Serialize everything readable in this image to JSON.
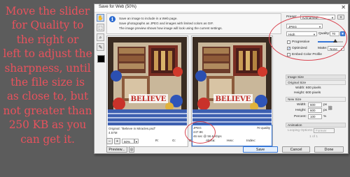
{
  "instruction": "Move the slider\nfor Quality to\nthe right or\nleft to adjust the\nsharpness, until\nthe file size is\nas close to, but\nnot greater than\n250 KB as you\ncan get it.",
  "window": {
    "title": "Save for Web (50%)",
    "close": "✕"
  },
  "toolbar_icons": [
    "hand-tool-icon",
    "zoom-tool-icon",
    "eyedropper-icon",
    "slice-select-icon"
  ],
  "info": {
    "lines": [
      "Save an image to include in a Web page.",
      "Save photographs as JPEG and images with limited colors as GIF.",
      "The image preview shows how image will look using the current settings."
    ]
  },
  "original": {
    "caption_label": "Original: \"Believe in Miracles.psd\"",
    "size": "4.57M",
    "title_text": "BELIEVE"
  },
  "optimized": {
    "format": "JPEG",
    "size": "247.9K",
    "time": "46 sec @ 56.6 Kbps",
    "quality_text": "70 quality",
    "title_text": "BELIEVE"
  },
  "bottom": {
    "zoom": "50%",
    "zoom_options_icon": "chevron-down-icon",
    "r_label": "R:",
    "g_label": "G:",
    "b_label": "B:",
    "alpha_label": "Alpha:",
    "hex_label": "Hex:",
    "index_label": "Index:",
    "preview_button": "Preview...",
    "save_button": "Save",
    "cancel_button": "Cancel",
    "done_button": "Done"
  },
  "settings": {
    "preset_label": "Preset:",
    "preset_value": "[Unnamed]",
    "format_value": "JPEG",
    "quality_preset": "High",
    "quality_label": "Quality:",
    "quality_value": "70",
    "quality_fraction": 0.7,
    "progressive_label": "Progressive",
    "progressive_checked": false,
    "optimized_label": "Optimized",
    "optimized_checked": true,
    "matte_label": "Matte:",
    "matte_value": "None",
    "embed_profile_label": "Embed Color Profile",
    "embed_profile_checked": false
  },
  "image_size": {
    "header": "Image Size",
    "original_header": "Original Size",
    "orig_width": "Width: 600 pixels",
    "orig_height": "Height: 600 pixels",
    "new_header": "New Size",
    "width_label": "Width:",
    "width_value": "600",
    "height_label": "Height:",
    "height_value": "600",
    "percent_label": "Percent:",
    "percent_value": "100",
    "unit_px": "px",
    "unit_pct": "%"
  },
  "animation": {
    "header": "Animation",
    "looping_label": "Looping Options:",
    "looping_value": "Forever",
    "frames": "1 of 1"
  },
  "colors": {
    "accent": "#3575d6",
    "annotation": "#d9434f"
  }
}
